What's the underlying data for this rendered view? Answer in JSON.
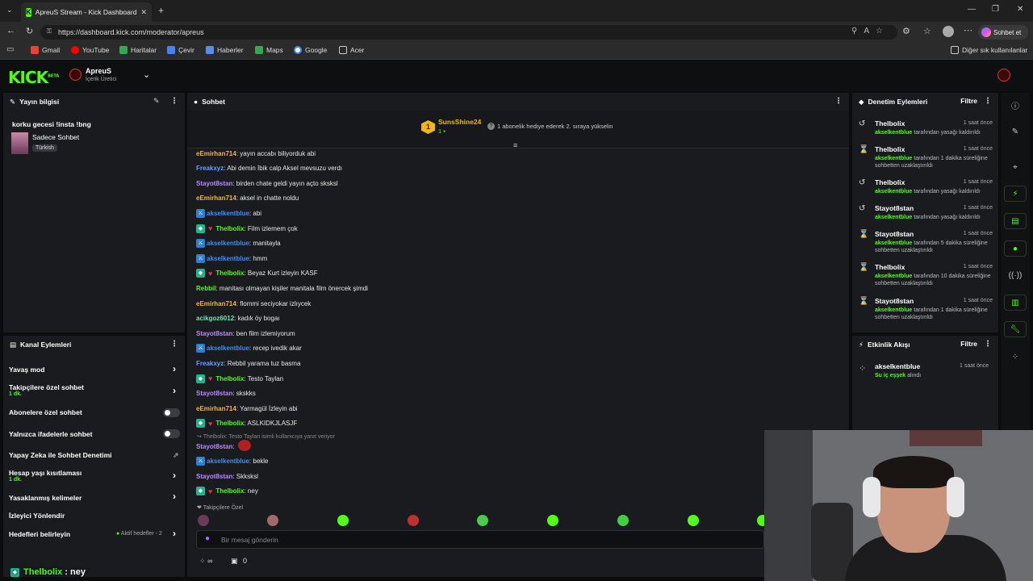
{
  "browser": {
    "tab_title": "ApreuS Stream - Kick Dashboard",
    "url": "https://dashboard.kick.com/moderator/apreus",
    "profile_button": "Sohbet et",
    "bookmarks": [
      "Gmail",
      "YouTube",
      "Haritalar",
      "Çevir",
      "Haberler",
      "Maps",
      "Google",
      "Acer"
    ],
    "other_bookmarks": "Diğer sık kullanılanlar"
  },
  "header": {
    "logo": "KICK",
    "logo_beta": "BETA",
    "channel_name": "ApreuS",
    "channel_role": "İçerik Üretici"
  },
  "stream_info": {
    "title": "Yayın bilgisi",
    "stream_title": "korku gecesi !insta !bng",
    "category": "Sadece Sohbet",
    "language": "Türkish"
  },
  "channel_actions": {
    "title": "Kanal Eylemleri",
    "items": [
      {
        "label": "Yavaş mod",
        "sub": ""
      },
      {
        "label": "Takipçilere özel sohbet",
        "sub": "1 dk."
      },
      {
        "label": "Abonelere özel sohbet",
        "sub": ""
      },
      {
        "label": "Yalnızca ifadelerle sohbet",
        "sub": ""
      },
      {
        "label": "Yapay Zeka ile Sohbet Denetimi",
        "sub": ""
      },
      {
        "label": "Hesap yaşı kısıtlaması",
        "sub": "1 dk."
      },
      {
        "label": "Yasaklanmış kelimeler",
        "sub": ""
      },
      {
        "label": "İzleyici Yönlendir",
        "sub": ""
      },
      {
        "label": "Hedefleri belirleyin",
        "sub": ""
      }
    ],
    "goals_status": "Aktif hedefler - 2"
  },
  "chat": {
    "title": "Sohbet",
    "pinned_user": "SunsShine24",
    "pinned_count": "1",
    "pinned_text": "1 abonelik hediye ederek 2. sıraya yükselin",
    "messages": [
      {
        "user": "eEmirhan714",
        "color": "#f0b840",
        "text": ": yayın accabı biliyorduk abi",
        "badges": ""
      },
      {
        "user": "Freakxyz",
        "color": "#6aa0ff",
        "text": ": Abi demin İbik calp Aksel mevsuzu verdı",
        "badges": ""
      },
      {
        "user": "Stayot8stan",
        "color": "#b98aff",
        "text": ": birden chate geldi yayın açto sksksl",
        "badges": ""
      },
      {
        "user": "eEmirhan714",
        "color": "#f0b840",
        "text": ": aksel in chatte noldu",
        "badges": ""
      },
      {
        "user": "akselkentblue",
        "color": "#3d8fff",
        "text": ": abi",
        "badges": "mod"
      },
      {
        "user": "Thelbolix",
        "color": "#53fc18",
        "text": ": Film izlemem çok",
        "badges": "sub"
      },
      {
        "user": "akselkentblue",
        "color": "#3d8fff",
        "text": ": manitayla",
        "badges": "mod"
      },
      {
        "user": "akselkentblue",
        "color": "#3d8fff",
        "text": ": hmm",
        "badges": "mod"
      },
      {
        "user": "Thelbolix",
        "color": "#53fc18",
        "text": ": Beyaz Kurt izleyin KASF",
        "badges": "sub"
      },
      {
        "user": "Rebbil",
        "color": "#53fc18",
        "text": ": manitası olmayan kişiler manitala film önercek şimdi",
        "badges": ""
      },
      {
        "user": "eEmirhan714",
        "color": "#f0b840",
        "text": ": flommi seciyokar izlıycek",
        "badges": ""
      },
      {
        "user": "acikgoz6012",
        "color": "#6fe8b0",
        "text": ": kadık öy bogaı",
        "badges": ""
      },
      {
        "user": "Stayot8stan",
        "color": "#b98aff",
        "text": ": ben film izlemiyorum",
        "badges": ""
      },
      {
        "user": "akselkentblue",
        "color": "#3d8fff",
        "text": ": recep ivedik akar",
        "badges": "mod"
      },
      {
        "user": "Freakxyz",
        "color": "#6aa0ff",
        "text": ": Rebbil yarama tuz basma",
        "badges": ""
      },
      {
        "user": "Thelbolix",
        "color": "#53fc18",
        "text": ": Testo Taylan",
        "badges": "sub"
      },
      {
        "user": "Stayot8stan",
        "color": "#b98aff",
        "text": ": skskks",
        "badges": ""
      },
      {
        "user": "eEmirhan714",
        "color": "#f0b840",
        "text": ": Yarmagül İzleyin abi",
        "badges": ""
      },
      {
        "user": "Thelbolix",
        "color": "#53fc18",
        "text": ": ASLKIDKJLASJF",
        "badges": "sub"
      }
    ],
    "reply_hint": "Thelbolix: Testo Taylan isimli kullanıcıya yanıt veriyor",
    "messages2": [
      {
        "user": "Stayot8stan",
        "color": "#b98aff",
        "text": ":",
        "badges": ""
      },
      {
        "user": "akselkentblue",
        "color": "#3d8fff",
        "text": ": bekle",
        "badges": "mod"
      },
      {
        "user": "Stayot8stan",
        "color": "#b98aff",
        "text": ": Skksksl",
        "badges": ""
      },
      {
        "user": "Thelbolix",
        "color": "#53fc18",
        "text": ": ney",
        "badges": "sub"
      }
    ],
    "followers_only": "Takipçilere Özel",
    "input_placeholder": "Bir mesaj gönderin",
    "infinity": "∞",
    "counter": "0"
  },
  "mod_actions": {
    "title": "Denetim Eylemleri",
    "filter": "Filtre",
    "items": [
      {
        "icon": "undo",
        "user": "Thelbolix",
        "time": "1 saat önce",
        "by": "akselkentblue",
        "desc": "tarafından yasağı kaldırıldı"
      },
      {
        "icon": "timer",
        "user": "Thelbolix",
        "time": "1 saat önce",
        "by": "akselkentblue",
        "desc": "tarafından 1 dakika süreliğine sohbetten uzaklaştırıldı"
      },
      {
        "icon": "undo",
        "user": "Thelbolix",
        "time": "1 saat önce",
        "by": "akselkentblue",
        "desc": "tarafından yasağı kaldırıldı"
      },
      {
        "icon": "undo",
        "user": "Stayot8stan",
        "time": "1 saat önce",
        "by": "akselkentblue",
        "desc": "tarafından yasağı kaldırıldı"
      },
      {
        "icon": "timer",
        "user": "Stayot8stan",
        "time": "1 saat önce",
        "by": "akselkentblue",
        "desc": "tarafından 5 dakika süreliğine sohbetten uzaklaştırıldı"
      },
      {
        "icon": "timer",
        "user": "Thelbolix",
        "time": "1 saat önce",
        "by": "akselkentblue",
        "desc": "tarafından 10 dakika süreliğine sohbetten uzaklaştırıldı"
      },
      {
        "icon": "timer",
        "user": "Stayot8stan",
        "time": "1 saat önce",
        "by": "akselkentblue",
        "desc": "tarafından 1 dakika süreliğine sohbetten uzaklaştırıldı"
      }
    ]
  },
  "activity": {
    "title": "Etkinlik Akışı",
    "filter": "Filtre",
    "user": "akselkentblue",
    "time": "1 saat önce",
    "desc_strong": "Su iç eşşek",
    "desc": "alındı"
  },
  "overlay": {
    "user": "Thelbolix",
    "text": " : ney"
  },
  "colors": {
    "accent": "#53fc18",
    "panel": "#191b1f",
    "bg": "#0b0c0d"
  }
}
